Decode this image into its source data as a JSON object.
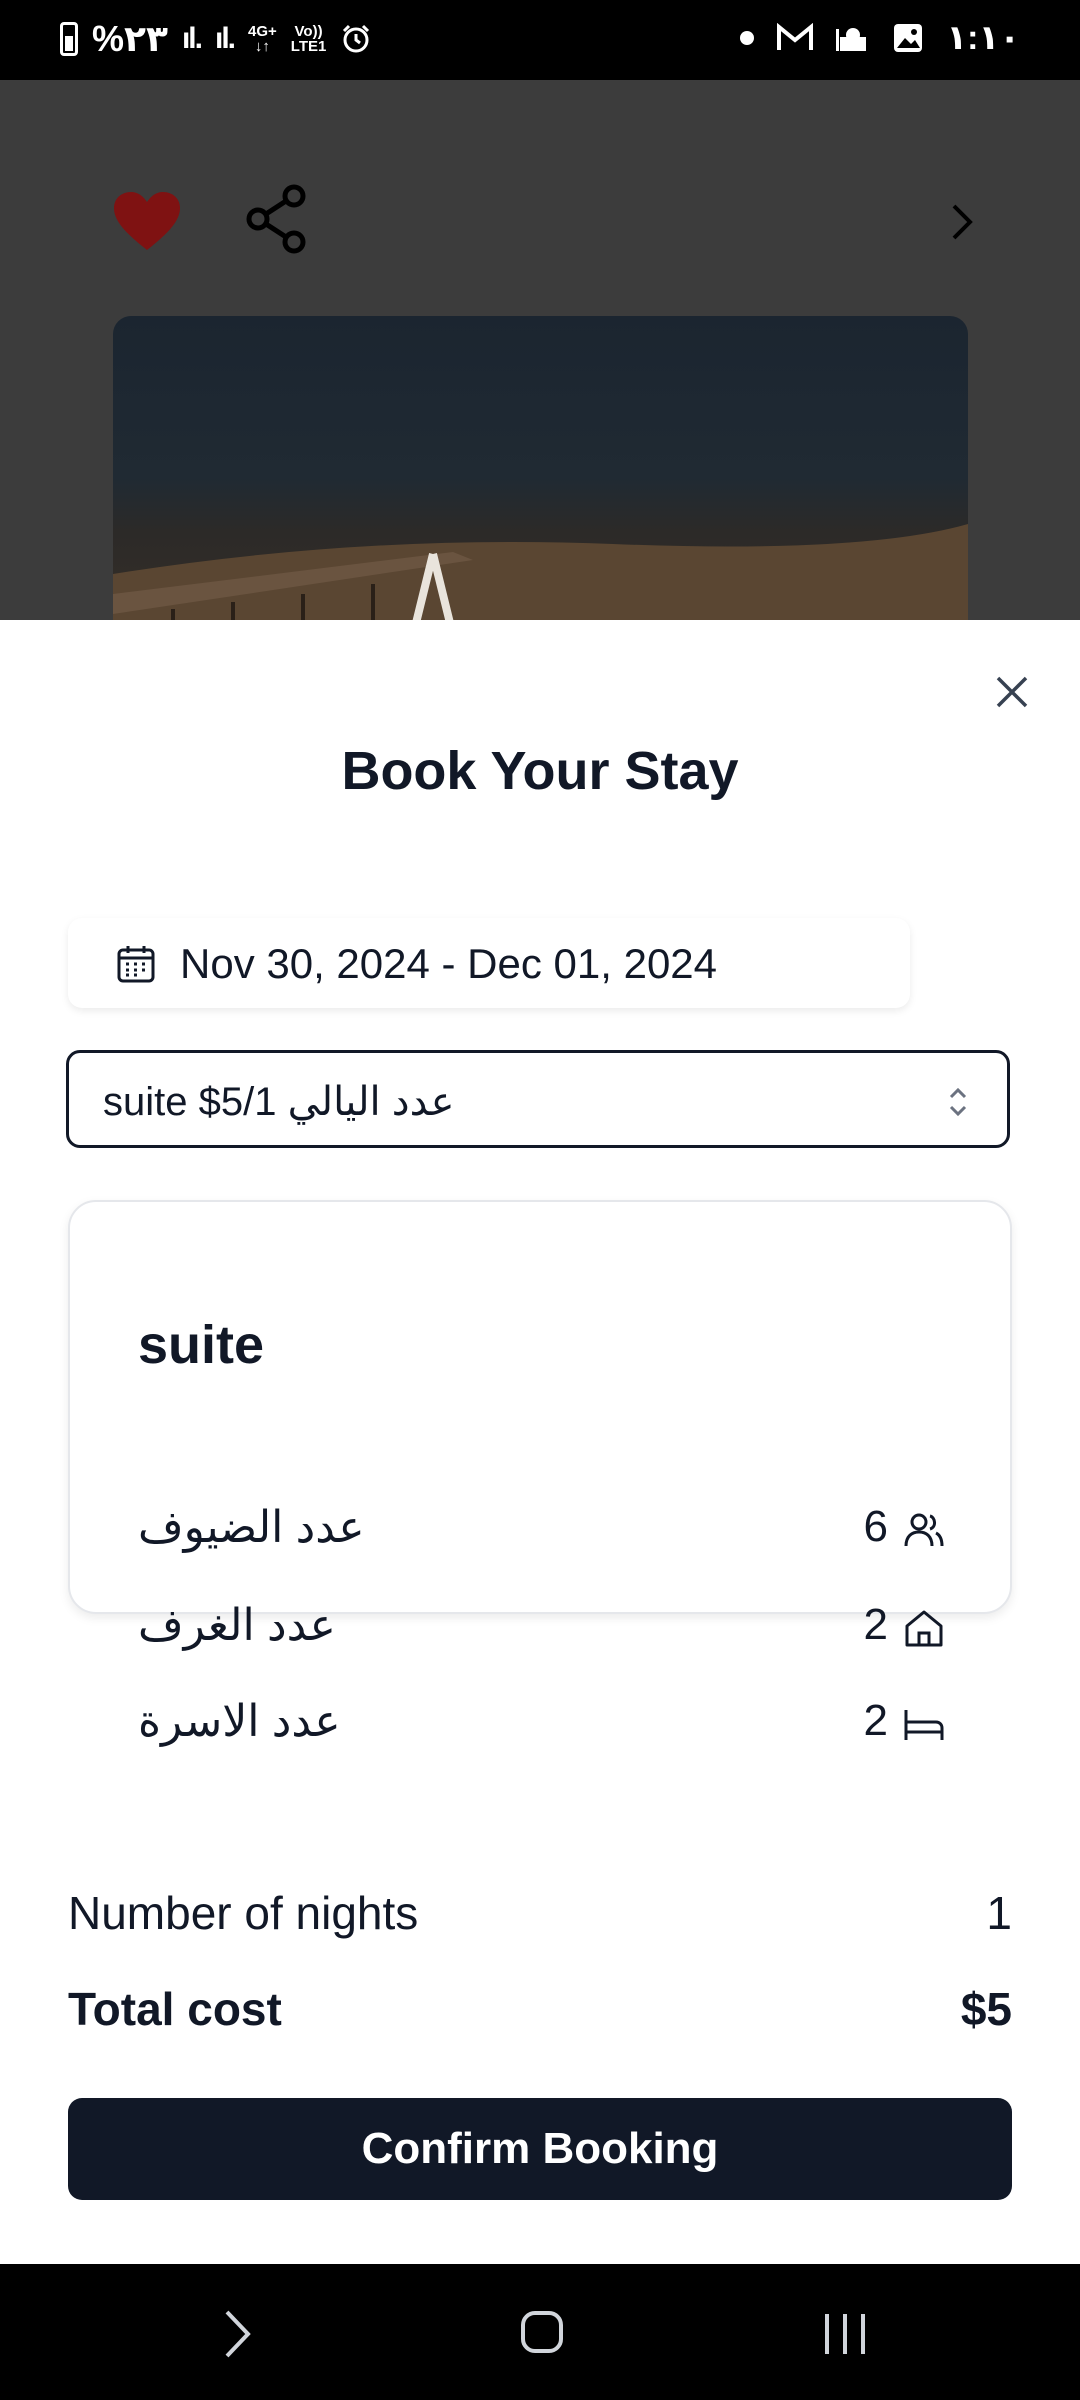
{
  "status_bar": {
    "battery_percent": "%٢٣",
    "network_type": "4G+",
    "volte": "Vo))",
    "lte": "LTE1",
    "time": "١:١٠"
  },
  "background": {
    "favorite_color": "#7f1212"
  },
  "sheet": {
    "title": "Book Your Stay",
    "date_range": "Nov 30, 2024 - Dec 01, 2024",
    "room_select_value": "suite $5/1 عدد اليالي",
    "room": {
      "name": "suite",
      "details": [
        {
          "label": "عدد الضيوف",
          "value": "6",
          "icon": "guests-icon"
        },
        {
          "label": "عدد الغرف",
          "value": "2",
          "icon": "home-icon"
        },
        {
          "label": "عدد الاسرة",
          "value": "2",
          "icon": "bed-icon"
        }
      ]
    },
    "nights_label": "Number of nights",
    "nights_value": "1",
    "total_label": "Total cost",
    "total_value": "$5",
    "confirm_label": "Confirm Booking"
  },
  "colors": {
    "primary": "#111827",
    "sheet_bg": "#ffffff",
    "overlay": "#3c3c3c"
  }
}
